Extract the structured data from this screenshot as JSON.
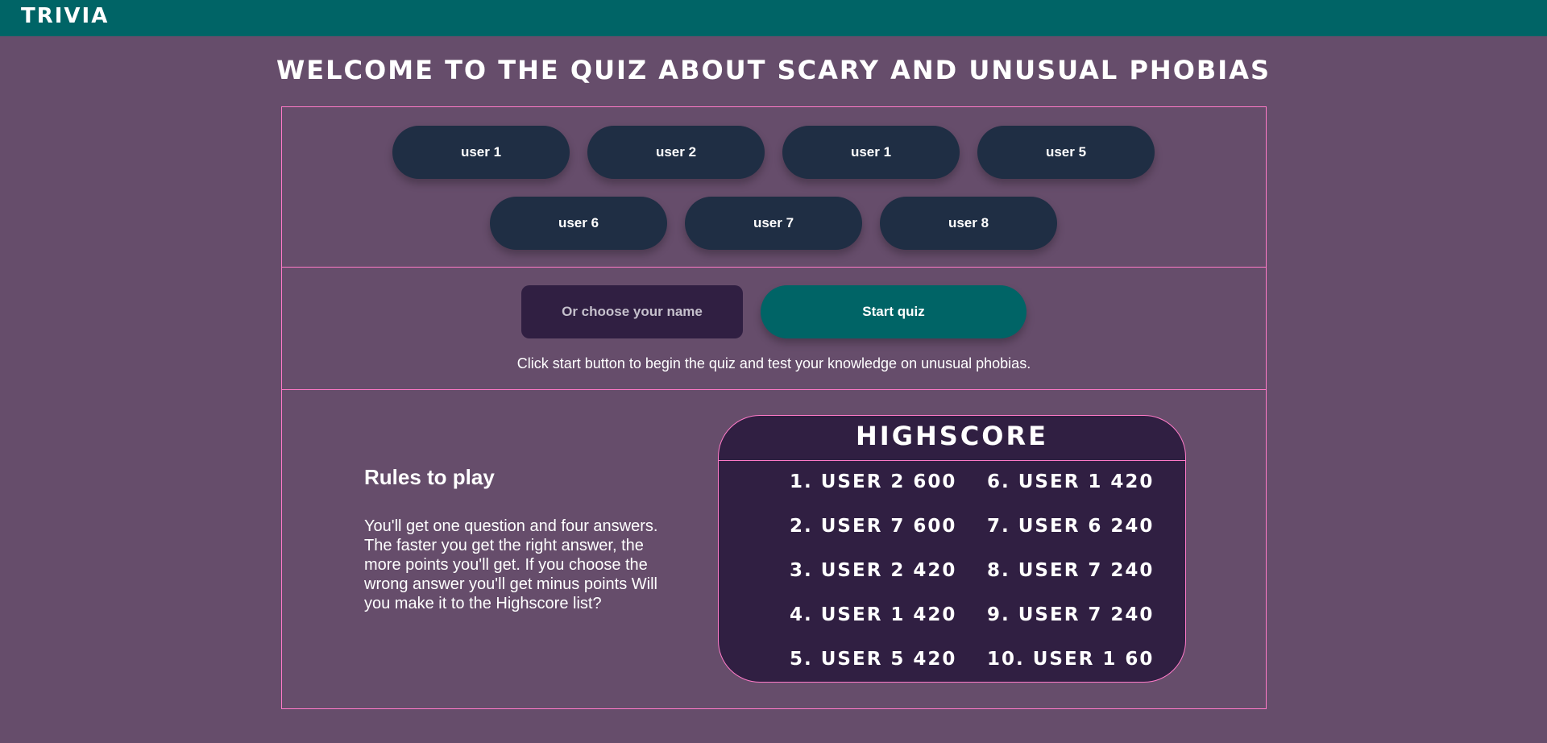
{
  "header": {
    "brand": "TRIVIA"
  },
  "title": "WELCOME TO THE QUIZ ABOUT SCARY AND UNUSUAL PHOBIAS",
  "users": [
    "user 1",
    "user 2",
    "user 1",
    "user 5",
    "user 6",
    "user 7",
    "user 8"
  ],
  "name_input": {
    "placeholder": "Or choose your name",
    "value": ""
  },
  "start_button": "Start quiz",
  "hint": "Click start button to begin the quiz and test your knowledge on unusual phobias.",
  "rules": {
    "title": "Rules to play",
    "text": "You'll get one question and four answers. The faster you get the right answer, the more points you'll get. If you choose the wrong answer you'll get minus points Will you make it to the Highscore list?"
  },
  "highscore": {
    "title": "HIGHSCORE",
    "entries": [
      "1. USER 2 600",
      "2. USER 7 600",
      "3. USER 2 420",
      "4. USER 1 420",
      "5. USER 5 420",
      "6. USER 1 420",
      "7. USER 6 240",
      "8. USER 7 240",
      "9. USER 7 240",
      "10. USER 1 60"
    ]
  },
  "colors": {
    "background": "#664d6b",
    "topbar": "#006466",
    "accent_border": "#ff7ac8",
    "user_button": "#1f2e44",
    "dark_panel": "#301f42",
    "start_button": "#006466"
  }
}
